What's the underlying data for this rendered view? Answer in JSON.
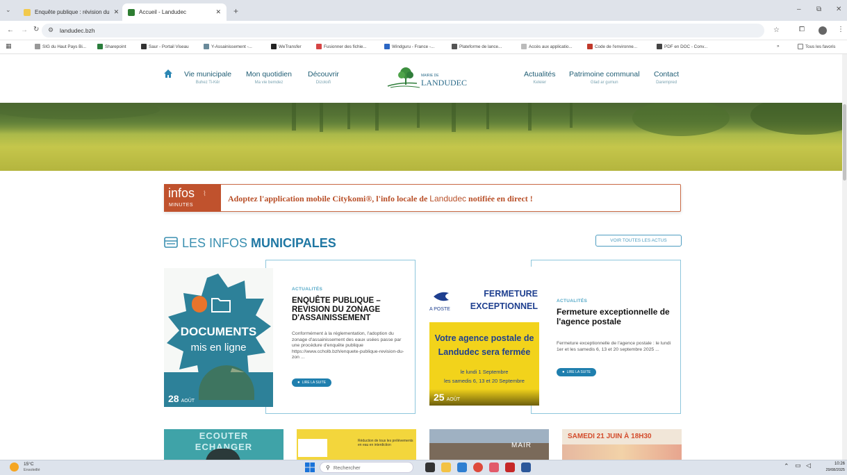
{
  "browser": {
    "tabs": [
      {
        "title": "Enquête publique : révision du",
        "active": false
      },
      {
        "title": "Accueil - Landudec",
        "active": true
      }
    ],
    "url": "landudec.bzh",
    "bookmarks": [
      "SIG du Haut Pays Bi...",
      "Sharepoint",
      "Saur - Portail Viseau",
      "Y-Assainissement -...",
      "WeTransfer",
      "Fusionner des fichie...",
      "Windguru - France -...",
      "Plateforme de lance...",
      "Accès aux applicatio...",
      "Code de l'environne...",
      "PDF en DOC - Conv..."
    ],
    "all_bookmarks_label": "Tous les favoris"
  },
  "site": {
    "nav_left": [
      {
        "label": "Vie municipale",
        "sub": "Buhez Ti-Kêr"
      },
      {
        "label": "Mon quotidien",
        "sub": "Ma vie bemdez"
      },
      {
        "label": "Découvrir",
        "sub": "Dizoloiñ"
      }
    ],
    "logo": {
      "small": "MAIRIE DE",
      "name": "LANDUDEC"
    },
    "nav_right": [
      {
        "label": "Actualités",
        "sub": "Keleier"
      },
      {
        "label": "Patrimoine communal",
        "sub": "Glad ar gumun"
      },
      {
        "label": "Contact",
        "sub": "Darempred"
      }
    ],
    "infos_banner": {
      "logo_big": "infos",
      "logo_small": "MINUTES",
      "text_a": "Adoptez l'application mobile Citykomi®, l'info locale de ",
      "text_b": "Landudec",
      "text_c": " notifiée en direct !"
    },
    "section": {
      "title_light": "LES INFOS ",
      "title_bold": "MUNICIPALES",
      "see_all": "VOIR TOUTES LES ACTUS"
    },
    "cards": [
      {
        "image_text_big": "DOCUMENTS",
        "image_text_small": "mis en ligne",
        "day": "28",
        "month": "AOÛT",
        "tag": "ACTUALITÉS",
        "title": "ENQUÊTE PUBLIQUE – REVISION DU ZONAGE D'ASSAINISSEMENT",
        "excerpt": "Conformément à la réglementation, l'adoption du zonage d'assainissement des eaux usées passe par une procédure d'enquête publique https://www.ccholb.bzh/enquete-publique-revision-du-zon ...",
        "button": "LIRE LA SUITE"
      },
      {
        "image_heading_1": "FERMETURE",
        "image_heading_2": "EXCEPTIONNEL",
        "image_brand": "A POSTE",
        "image_line_1": "Votre agence postale de",
        "image_line_2": "Landudec sera fermée",
        "image_line_3": "le lundi 1 Septembre",
        "image_line_4": "les samedis 6, 13 et 20 Septembre",
        "day": "25",
        "month": "AOÛT",
        "tag": "ACTUALITÉS",
        "title": "Fermeture exceptionnelle de l'agence postale",
        "excerpt": "Fermeture exceptionnelle de l'agence postale : le lundi 1er et les samedis 6, 13 et 20 septembre 2025 ...",
        "button": "LIRE LA SUITE"
      }
    ],
    "bottom_cards": [
      {
        "text_1": "ECOUTER",
        "text_2": "ECHANGER"
      },
      {
        "text_1": "Réduction de tous les prélèvements en eau en interdiction"
      },
      {
        "text_1": "MAIR"
      },
      {
        "text_1": "SAMEDI 21 JUIN À 18H30"
      }
    ]
  },
  "taskbar": {
    "weather_temp": "15°C",
    "weather_desc": "Ensoleillé",
    "search_placeholder": "Rechercher",
    "time": "10:26",
    "date": "29/08/2025"
  }
}
